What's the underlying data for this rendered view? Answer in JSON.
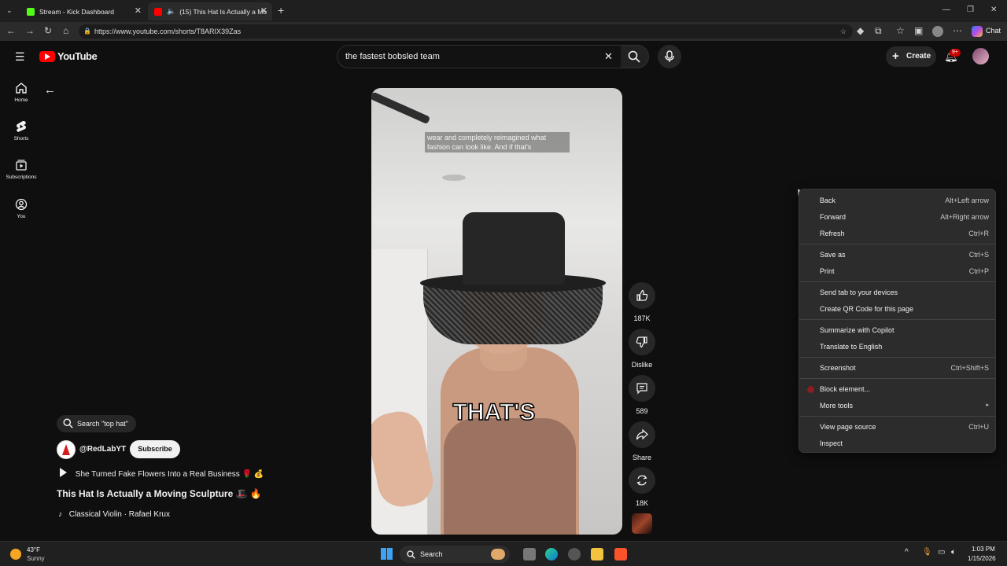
{
  "browser": {
    "tabs": [
      {
        "title": "Stream - Kick Dashboard",
        "active": false
      },
      {
        "title": "(15) This Hat Is Actually a Mo",
        "active": true
      }
    ],
    "url": "https://www.youtube.com/shorts/T8ARIX39Zas",
    "chat_label": "Chat"
  },
  "youtube": {
    "logo_text": "YouTube",
    "search_value": "the fastest bobsled team",
    "create_label": "Create",
    "notification_badge": "9+",
    "sidebar": [
      {
        "label": "Home"
      },
      {
        "label": "Shorts"
      },
      {
        "label": "Subscriptions"
      },
      {
        "label": "You"
      }
    ]
  },
  "short": {
    "subtitle": "wear and completely reimagined what fashion can look like. And if that's",
    "caption": "THAT'S",
    "search_chip": "Search \"top hat\"",
    "channel": "@RedLabYT",
    "subscribe_label": "Subscribe",
    "related_title": "She Turned Fake Flowers Into a Real Business 🌹 💰",
    "title": "This Hat Is Actually a Moving Sculpture 🎩 🔥",
    "music": "Classical Violin · Rafael Krux",
    "actions": {
      "likes": "187K",
      "dislike_label": "Dislike",
      "comments": "589",
      "share_label": "Share",
      "remix": "18K"
    }
  },
  "context_menu": [
    {
      "label": "Back",
      "shortcut": "Alt+Left arrow"
    },
    {
      "label": "Forward",
      "shortcut": "Alt+Right arrow"
    },
    {
      "label": "Refresh",
      "shortcut": "Ctrl+R"
    },
    {
      "label": "Save as",
      "shortcut": "Ctrl+S"
    },
    {
      "label": "Print",
      "shortcut": "Ctrl+P"
    },
    {
      "label": "Send tab to your devices",
      "shortcut": ""
    },
    {
      "label": "Create QR Code for this page",
      "shortcut": ""
    },
    {
      "label": "Summarize with Copilot",
      "shortcut": ""
    },
    {
      "label": "Translate to English",
      "shortcut": ""
    },
    {
      "label": "Screenshot",
      "shortcut": "Ctrl+Shift+S"
    },
    {
      "label": "Block element...",
      "shortcut": ""
    },
    {
      "label": "More tools",
      "shortcut": ""
    },
    {
      "label": "View page source",
      "shortcut": "Ctrl+U"
    },
    {
      "label": "Inspect",
      "shortcut": ""
    }
  ],
  "taskbar": {
    "weather_temp": "43°F",
    "weather_cond": "Sunny",
    "search_label": "Search",
    "time": "1:03 PM",
    "date": "1/15/2026"
  },
  "colors": {
    "youtube_red": "#ff0000",
    "kick_green": "#53fc18",
    "menu_bg": "#2c2c2c"
  }
}
